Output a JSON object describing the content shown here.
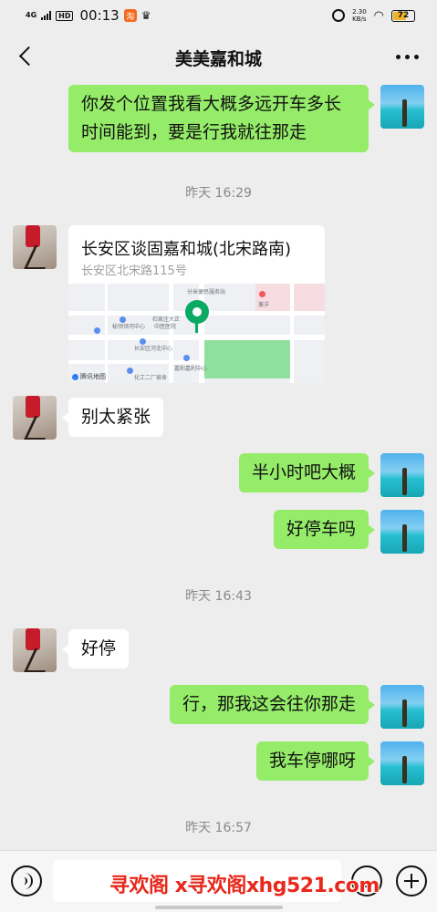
{
  "status_bar": {
    "network": "4G",
    "hd": "HD",
    "time": "00:13",
    "app_badge": "淘",
    "speed_value": "2.30",
    "speed_unit": "KB/s",
    "battery": "72",
    "battery_color": "#f0b323"
  },
  "header": {
    "title": "美美嘉和城",
    "back_icon": "chevron-left-icon",
    "more_icon": "more-dots-icon"
  },
  "messages": [
    {
      "sender": "me",
      "type": "text",
      "text": "你发个位置我看大概多远开车多长时间能到，要是行我就往那走"
    },
    {
      "type": "timestamp",
      "text": "昨天 16:29"
    },
    {
      "sender": "other",
      "type": "location",
      "name": "长安区谈固嘉和城(北宋路南)",
      "address": "长安区北宋路115号",
      "map_brand": "腾讯地图",
      "map_labels": [
        "分米便民服务站",
        "兼洋",
        "秘领领河中心",
        "石家庄大正",
        "中医医院",
        "长安区河北中心",
        "嘉和嘉利中心",
        "化工二厂宿舍"
      ]
    },
    {
      "sender": "other",
      "type": "text",
      "text": "别太紧张"
    },
    {
      "sender": "me",
      "type": "text",
      "text": "半小时吧大概"
    },
    {
      "sender": "me",
      "type": "text",
      "text": "好停车吗"
    },
    {
      "type": "timestamp",
      "text": "昨天 16:43"
    },
    {
      "sender": "other",
      "type": "text",
      "text": "好停"
    },
    {
      "sender": "me",
      "type": "text",
      "text": "行，那我这会往你那走"
    },
    {
      "sender": "me",
      "type": "text",
      "text": "我车停哪呀"
    },
    {
      "type": "timestamp",
      "text": "昨天 16:57"
    }
  ],
  "input_bar": {
    "voice_icon": "voice-icon",
    "emoji_icon": "emoji-icon",
    "plus_icon": "plus-icon",
    "value": ""
  },
  "colors": {
    "bubble_me": "#95ec69",
    "bubble_other": "#ffffff",
    "background": "#ededed",
    "watermark": "#e8281b"
  },
  "watermark": "寻欢阁 x寻欢阁xhg521.com"
}
